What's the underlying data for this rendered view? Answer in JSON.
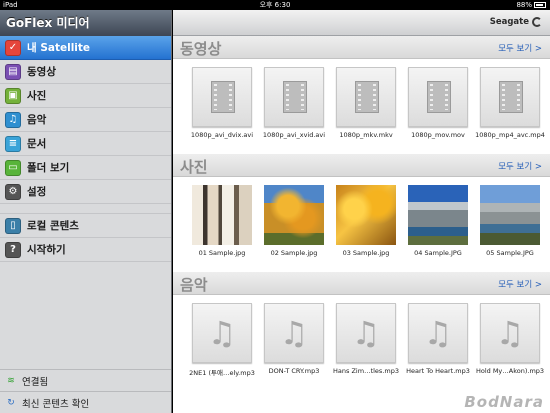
{
  "status": {
    "device": "iPad",
    "time": "오후 6:30",
    "battery": "88%"
  },
  "sidebar": {
    "title": "GoFlex 미디어",
    "items": [
      {
        "label": "내 Satellite",
        "icon": "satellite-icon",
        "color": "#e5453b",
        "glyph": "✓",
        "active": true
      },
      {
        "label": "동영상",
        "icon": "video-icon",
        "color": "#7a4fb3",
        "glyph": "▤",
        "active": false
      },
      {
        "label": "사진",
        "icon": "photo-icon",
        "color": "#74b13a",
        "glyph": "▣",
        "active": false
      },
      {
        "label": "음악",
        "icon": "music-icon",
        "color": "#2f8fd0",
        "glyph": "♫",
        "active": false
      },
      {
        "label": "문서",
        "icon": "document-icon",
        "color": "#3aa3d8",
        "glyph": "≡",
        "active": false
      },
      {
        "label": "폴더 보기",
        "icon": "folder-icon",
        "color": "#58b43a",
        "glyph": "▭",
        "active": false
      },
      {
        "label": "설정",
        "icon": "gear-icon",
        "color": "#555555",
        "glyph": "⚙",
        "active": false
      }
    ],
    "items2": [
      {
        "label": "로컬 콘텐츠",
        "icon": "local-content-icon",
        "color": "#3b7fa8",
        "glyph": "▯"
      },
      {
        "label": "시작하기",
        "icon": "help-icon",
        "color": "#555555",
        "glyph": "?"
      }
    ],
    "footer": {
      "connected": "연결됨",
      "check_latest": "최신 콘텐츠 확인"
    }
  },
  "header": {
    "brand": "Seagate"
  },
  "sections": {
    "video": {
      "title": "동영상",
      "more": "모두 보기 >",
      "items": [
        "1080p_avi_dvix.avi",
        "1080p_avi_xvid.avi",
        "1080p_mkv.mkv",
        "1080p_mov.mov",
        "1080p_mp4_avc.mp4"
      ]
    },
    "photo": {
      "title": "사진",
      "more": "모두 보기 >",
      "items": [
        "01 Sample.jpg",
        "02 Sample.jpg",
        "03 Sample.jpg",
        "04 Sample.JPG",
        "05 Sample.JPG"
      ]
    },
    "music": {
      "title": "음악",
      "more": "모두 보기 >",
      "items": [
        "2NE1 (투애…ely.mp3",
        "DON-T CRY.mp3",
        "Hans Zim…tles.mp3",
        "Heart To Heart.mp3",
        "Hold My…Akon).mp3"
      ]
    }
  },
  "watermark": "BodNara"
}
